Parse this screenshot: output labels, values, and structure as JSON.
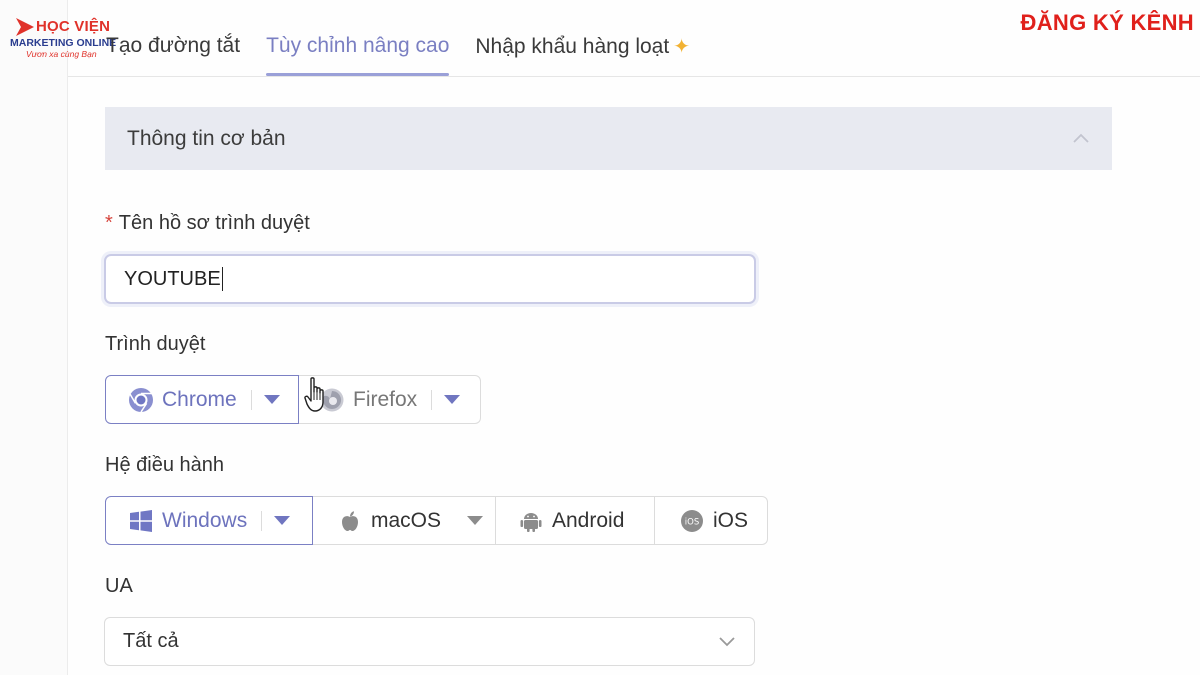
{
  "logo": {
    "line1": "HỌC VIỆN",
    "line2": "MARKETING ONLINE",
    "line3": "Vươn xa cùng Bạn"
  },
  "subscribe_label": "ĐĂNG KÝ KÊNH",
  "tabs": [
    {
      "label": "Tạo đường tắt",
      "active": false
    },
    {
      "label": "Tùy chỉnh nâng cao",
      "active": true
    },
    {
      "label": "Nhập khẩu hàng loạt",
      "active": false
    }
  ],
  "section": {
    "title": "Thông tin cơ bản"
  },
  "profile_name": {
    "label": "Tên hồ sơ trình duyệt",
    "required_mark": "*",
    "value": "YOUTUBE"
  },
  "browser": {
    "label": "Trình duyệt",
    "options": [
      {
        "label": "Chrome",
        "icon": "chrome-icon",
        "selected": true
      },
      {
        "label": "Firefox",
        "icon": "firefox-icon",
        "selected": false
      }
    ]
  },
  "os": {
    "label": "Hệ điều hành",
    "options": [
      {
        "label": "Windows",
        "icon": "windows-icon",
        "selected": true
      },
      {
        "label": "macOS",
        "icon": "apple-icon",
        "selected": false
      },
      {
        "label": "Android",
        "icon": "android-icon",
        "selected": false
      },
      {
        "label": "iOS",
        "icon": "ios-icon",
        "selected": false
      }
    ]
  },
  "ua": {
    "label": "UA",
    "value": "Tất cả"
  },
  "colors": {
    "accent": "#7a7fc2",
    "brand_red": "#e0201b",
    "section_bg": "#e8eaf1"
  }
}
